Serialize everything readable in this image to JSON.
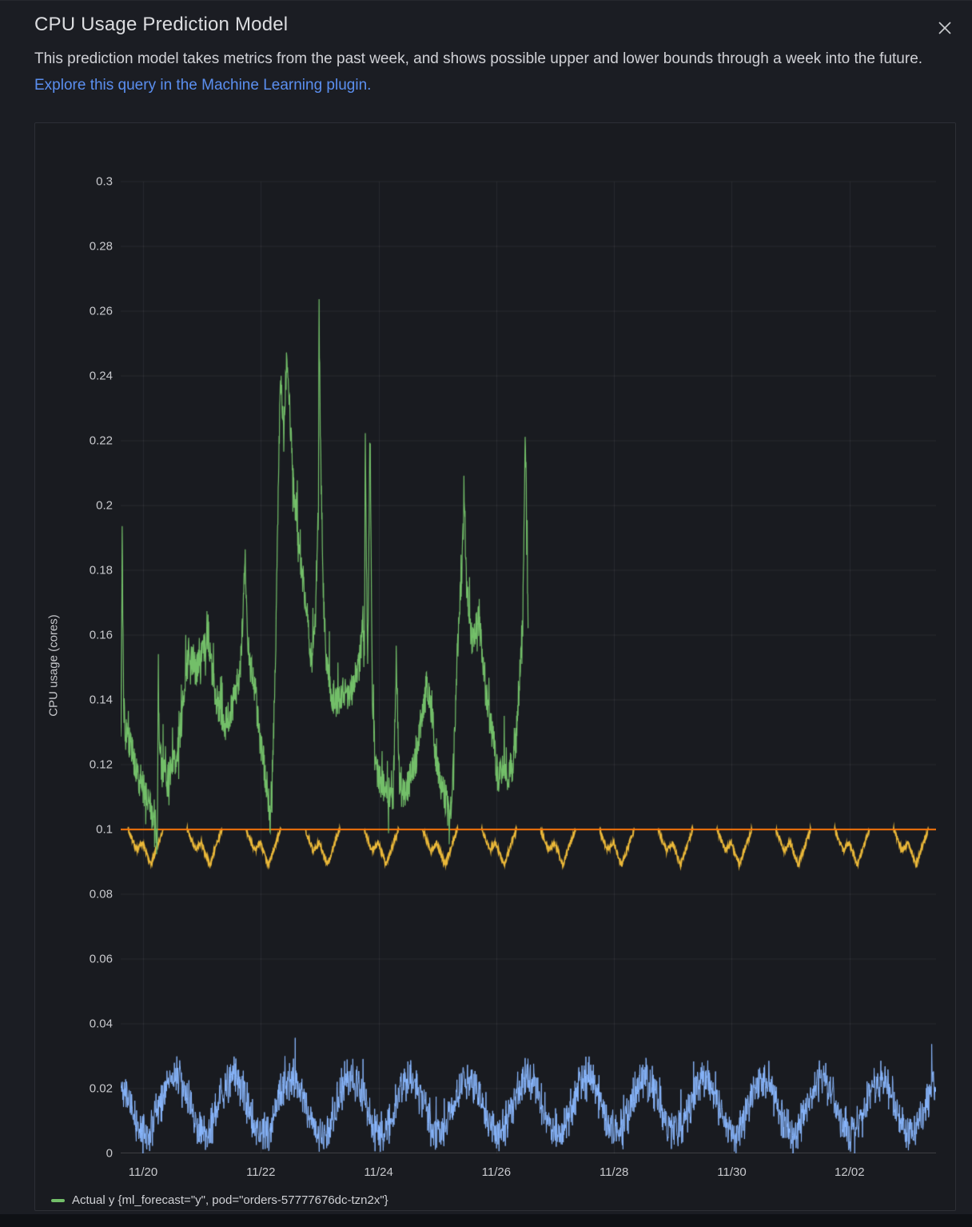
{
  "header": {
    "title": "CPU Usage Prediction Model",
    "description": "This prediction model takes metrics from the past week, and shows possible upper and lower bounds through a week into the future.",
    "link_text": "Explore this query in the Machine Learning plugin.",
    "link_color": "#5b8ff0",
    "close_label": "close"
  },
  "chart": {
    "ylabel": "CPU usage (cores)",
    "legend": [
      {
        "label": "Actual y {ml_forecast=\"y\", pod=\"orders-57777676dc-tzn2x\"}",
        "color": "#73bf69"
      }
    ],
    "colors": {
      "grid": "rgba(255,255,255,0.065)",
      "axis_line": "rgba(255,255,255,0.17)",
      "tick_text": "#c8c9cd",
      "green": "#73bf69",
      "orange": "#ff780a",
      "yellow": "#eab839",
      "blue": "#8ab8ff"
    }
  },
  "chart_data": {
    "type": "line",
    "title": "CPU Usage Prediction Model",
    "ylabel": "CPU usage (cores)",
    "ylim": [
      0,
      0.305
    ],
    "grid": true,
    "x_unit": "days relative to 11/20 00:00",
    "xlim": [
      -0.38,
      13.47
    ],
    "seed": 42,
    "x_ticks": [
      {
        "label": "11/20",
        "t": 0
      },
      {
        "label": "11/22",
        "t": 2
      },
      {
        "label": "11/24",
        "t": 4
      },
      {
        "label": "11/26",
        "t": 6
      },
      {
        "label": "11/28",
        "t": 8
      },
      {
        "label": "11/30",
        "t": 10
      },
      {
        "label": "12/02",
        "t": 12
      }
    ],
    "y_ticks": [
      {
        "label": "0",
        "v": 0
      },
      {
        "label": "0.02",
        "v": 0.02
      },
      {
        "label": "0.04",
        "v": 0.04
      },
      {
        "label": "0.06",
        "v": 0.06
      },
      {
        "label": "0.08",
        "v": 0.08
      },
      {
        "label": "0.1",
        "v": 0.1
      },
      {
        "label": "0.12",
        "v": 0.12
      },
      {
        "label": "0.14",
        "v": 0.14
      },
      {
        "label": "0.16",
        "v": 0.16
      },
      {
        "label": "0.18",
        "v": 0.18
      },
      {
        "label": "0.2",
        "v": 0.2
      },
      {
        "label": "0.22",
        "v": 0.22
      },
      {
        "label": "0.24",
        "v": 0.24
      },
      {
        "label": "0.26",
        "v": 0.26
      },
      {
        "label": "0.28",
        "v": 0.28
      },
      {
        "label": "0.3",
        "v": 0.3
      }
    ],
    "series": [
      {
        "id": "actual-y",
        "name": "Actual y {ml_forecast=\"y\", pod=\"orders-57777676dc-tzn2x\"}",
        "color": "#73bf69",
        "style": "noisy-line",
        "line_width": 1.2,
        "noise": 0.011,
        "keypoints": [
          [
            -0.38,
            0.125
          ],
          [
            -0.353,
            0.187
          ],
          [
            -0.33,
            0.14
          ],
          [
            -0.312,
            0.131
          ],
          [
            -0.244,
            0.127
          ],
          [
            -0.177,
            0.124
          ],
          [
            -0.109,
            0.118
          ],
          [
            -0.027,
            0.113
          ],
          [
            0.054,
            0.111
          ],
          [
            0.136,
            0.107
          ],
          [
            0.204,
            0.097
          ],
          [
            0.244,
            0.094
          ],
          [
            0.258,
            0.155
          ],
          [
            0.272,
            0.128
          ],
          [
            0.326,
            0.118
          ],
          [
            0.407,
            0.114
          ],
          [
            0.489,
            0.12
          ],
          [
            0.57,
            0.123
          ],
          [
            0.652,
            0.133
          ],
          [
            0.72,
            0.147
          ],
          [
            0.787,
            0.156
          ],
          [
            0.842,
            0.152
          ],
          [
            0.91,
            0.149
          ],
          [
            0.978,
            0.152
          ],
          [
            1.046,
            0.156
          ],
          [
            1.1,
            0.162
          ],
          [
            1.154,
            0.151
          ],
          [
            1.222,
            0.142
          ],
          [
            1.303,
            0.137
          ],
          [
            1.398,
            0.133
          ],
          [
            1.493,
            0.137
          ],
          [
            1.575,
            0.142
          ],
          [
            1.656,
            0.15
          ],
          [
            1.711,
            0.172
          ],
          [
            1.738,
            0.184
          ],
          [
            1.778,
            0.158
          ],
          [
            1.833,
            0.149
          ],
          [
            1.901,
            0.143
          ],
          [
            1.969,
            0.131
          ],
          [
            2.05,
            0.12
          ],
          [
            2.118,
            0.112
          ],
          [
            2.159,
            0.104
          ],
          [
            2.2,
            0.118
          ],
          [
            2.254,
            0.155
          ],
          [
            2.295,
            0.205
          ],
          [
            2.335,
            0.241
          ],
          [
            2.39,
            0.222
          ],
          [
            2.444,
            0.246
          ],
          [
            2.498,
            0.228
          ],
          [
            2.553,
            0.205
          ],
          [
            2.62,
            0.192
          ],
          [
            2.688,
            0.18
          ],
          [
            2.756,
            0.172
          ],
          [
            2.824,
            0.158
          ],
          [
            2.878,
            0.152
          ],
          [
            2.932,
            0.165
          ],
          [
            2.98,
            0.2
          ],
          [
            2.987,
            0.264
          ],
          [
            3.0,
            0.24
          ],
          [
            3.027,
            0.205
          ],
          [
            3.068,
            0.168
          ],
          [
            3.122,
            0.15
          ],
          [
            3.19,
            0.143
          ],
          [
            3.285,
            0.139
          ],
          [
            3.394,
            0.143
          ],
          [
            3.502,
            0.14
          ],
          [
            3.597,
            0.146
          ],
          [
            3.679,
            0.152
          ],
          [
            3.733,
            0.165
          ],
          [
            3.76,
            0.15
          ],
          [
            3.774,
            0.224
          ],
          [
            3.815,
            0.15
          ],
          [
            3.856,
            0.225
          ],
          [
            3.896,
            0.14
          ],
          [
            3.951,
            0.12
          ],
          [
            4.032,
            0.114
          ],
          [
            4.141,
            0.111
          ],
          [
            4.249,
            0.11
          ],
          [
            4.304,
            0.152
          ],
          [
            4.358,
            0.112
          ],
          [
            4.453,
            0.111
          ],
          [
            4.548,
            0.116
          ],
          [
            4.643,
            0.123
          ],
          [
            4.738,
            0.136
          ],
          [
            4.82,
            0.146
          ],
          [
            4.888,
            0.138
          ],
          [
            4.969,
            0.124
          ],
          [
            5.05,
            0.115
          ],
          [
            5.132,
            0.11
          ],
          [
            5.2,
            0.103
          ],
          [
            5.254,
            0.112
          ],
          [
            5.308,
            0.14
          ],
          [
            5.363,
            0.165
          ],
          [
            5.417,
            0.18
          ],
          [
            5.458,
            0.202
          ],
          [
            5.498,
            0.172
          ],
          [
            5.553,
            0.16
          ],
          [
            5.621,
            0.158
          ],
          [
            5.688,
            0.166
          ],
          [
            5.756,
            0.156
          ],
          [
            5.824,
            0.143
          ],
          [
            5.892,
            0.133
          ],
          [
            5.96,
            0.126
          ],
          [
            6.028,
            0.115
          ],
          [
            6.109,
            0.12
          ],
          [
            6.19,
            0.117
          ],
          [
            6.272,
            0.12
          ],
          [
            6.339,
            0.128
          ],
          [
            6.407,
            0.152
          ],
          [
            6.448,
            0.162
          ],
          [
            6.489,
            0.216
          ],
          [
            6.502,
            0.214
          ],
          [
            6.516,
            0.195
          ],
          [
            6.543,
            0.156
          ]
        ]
      },
      {
        "id": "upper-bound-line",
        "color": "#ff780a",
        "style": "constant",
        "line_width": 2,
        "value": 0.1,
        "t_range": [
          -0.38,
          13.47
        ]
      },
      {
        "id": "lower-bound-line",
        "color": "#eab839",
        "style": "baseline-with-daily-dips",
        "line_width": 1.6,
        "baseline": 0.1,
        "noise": 0.0008,
        "dip_centers_t": [
          0.08,
          1.08,
          2.08,
          3.08,
          4.08,
          5.08,
          6.08,
          7.08,
          8.08,
          9.08,
          10.08,
          11.08,
          12.08,
          13.08
        ],
        "dip_shape": [
          [
            -0.33,
            0
          ],
          [
            -0.19,
            -0.0065
          ],
          [
            -0.09,
            -0.004
          ],
          [
            0.05,
            -0.011
          ],
          [
            0.18,
            -0.004
          ],
          [
            0.26,
            0
          ]
        ]
      },
      {
        "id": "predicted-daily-series",
        "color": "#8ab8ff",
        "style": "daily-oscillation-noisy",
        "line_width": 1,
        "mean": 0.0145,
        "amplitude": 0.0085,
        "peak_phase_t": 0.53,
        "noise": 0.0075,
        "t_range": [
          -0.38,
          13.47
        ]
      }
    ]
  }
}
